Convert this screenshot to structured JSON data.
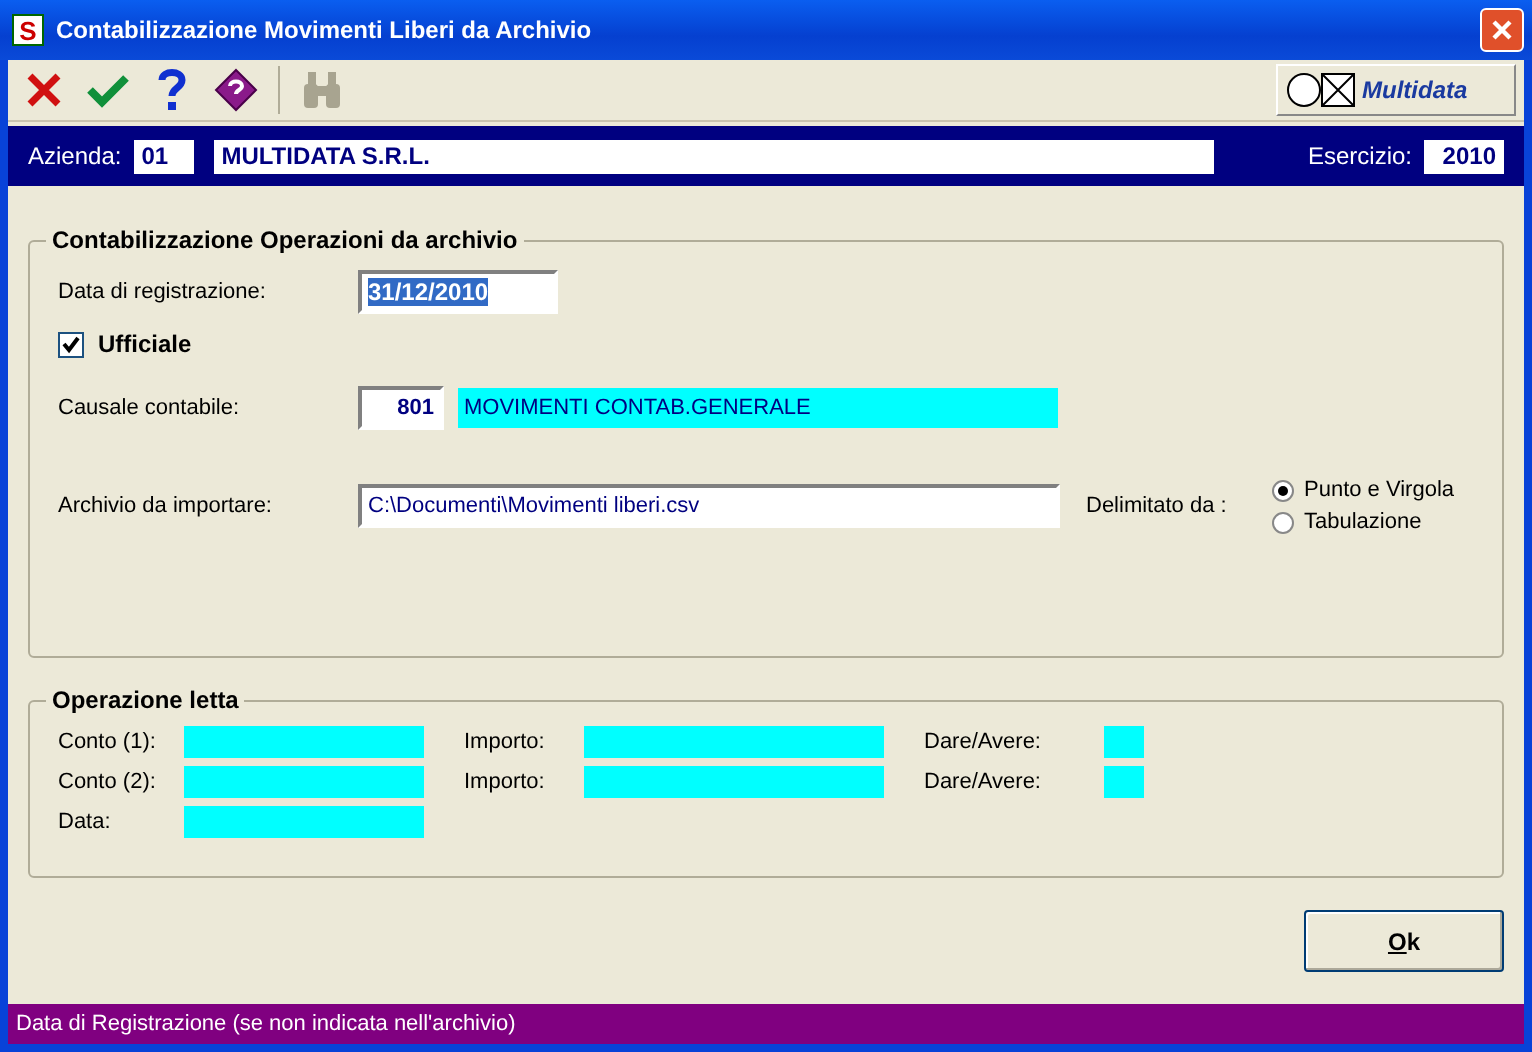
{
  "window": {
    "title": "Contabilizzazione Movimenti Liberi da Archivio",
    "app_icon_text": "S"
  },
  "toolbar": {
    "buttons": [
      {
        "kind": "cancel",
        "disabled": false
      },
      {
        "kind": "confirm",
        "disabled": false
      },
      {
        "kind": "help",
        "disabled": false
      },
      {
        "kind": "book",
        "disabled": false
      },
      {
        "kind": "search",
        "disabled": true
      }
    ],
    "logo": "Multidata"
  },
  "header": {
    "azienda_label": "Azienda:",
    "azienda_code": "01",
    "azienda_name": "MULTIDATA S.R.L.",
    "esercizio_label": "Esercizio:",
    "esercizio": "2010"
  },
  "import_group": {
    "title": "Contabilizzazione Operazioni da archivio",
    "date_label": "Data di registrazione:",
    "date": "31/12/2010",
    "ufficiale": {
      "label": "Ufficiale",
      "checked": true
    },
    "causale_label": "Causale contabile:",
    "causale_code": "801",
    "causale_desc": "MOVIMENTI CONTAB.GENERALE",
    "file_label": "Archivio da importare:",
    "file": "C:\\Documenti\\Movimenti liberi.csv",
    "delimiter_label": "Delimitato da :",
    "delimiters": [
      {
        "label": "Punto e Virgola",
        "selected": true
      },
      {
        "label": "Tabulazione",
        "selected": false
      }
    ]
  },
  "read_group": {
    "title": "Operazione letta",
    "rows": [
      {
        "label": "Conto (1):",
        "importo_label": "Importo:",
        "dare_avere_label": "Dare/Avere:"
      },
      {
        "label": "Conto (2):",
        "importo_label": "Importo:",
        "dare_avere_label": "Dare/Avere:"
      },
      {
        "label": "Data:"
      }
    ]
  },
  "ok_button": "Ok",
  "status_bar": "Data di Registrazione (se non indicata nell'archivio)"
}
